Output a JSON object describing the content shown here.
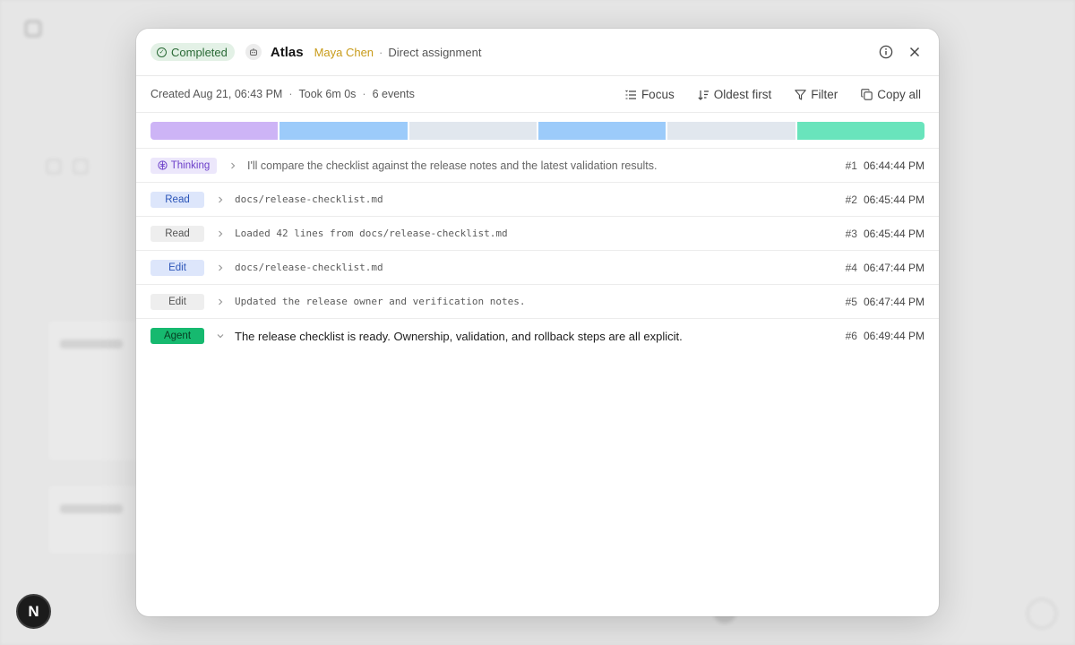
{
  "modal": {
    "status": "Completed",
    "agent_name": "Atlas",
    "assignee": "Maya Chen",
    "separator": "·",
    "assignment_type": "Direct assignment",
    "created": "Created Aug 21, 06:43 PM",
    "duration": "Took 6m 0s",
    "event_count": "6 events",
    "toolbar": {
      "focus": "Focus",
      "sort": "Oldest first",
      "filter": "Filter",
      "copy": "Copy all"
    },
    "timeline_colors": [
      "#cdb4f6",
      "#9ccbfa",
      "#e1e7ee",
      "#9ccbfa",
      "#e1e7ee",
      "#69e4bc"
    ],
    "events": [
      {
        "tag": "Thinking",
        "text": "I'll compare the checklist against the release notes and the latest validation results.",
        "num": "#1",
        "time": "06:44:44 PM"
      },
      {
        "tag": "Read",
        "text": "docs/release-checklist.md",
        "num": "#2",
        "time": "06:45:44 PM"
      },
      {
        "tag": "Read",
        "text": "Loaded 42 lines from docs/release-checklist.md",
        "num": "#3",
        "time": "06:45:44 PM"
      },
      {
        "tag": "Edit",
        "text": "docs/release-checklist.md",
        "num": "#4",
        "time": "06:47:44 PM"
      },
      {
        "tag": "Edit",
        "text": "Updated the release owner and verification notes.",
        "num": "#5",
        "time": "06:47:44 PM"
      },
      {
        "tag": "Agent",
        "text": "The release checklist is ready. Ownership, validation, and rollback steps are all explicit.",
        "num": "#6",
        "time": "06:49:44 PM"
      }
    ]
  },
  "corner_badge": "N"
}
